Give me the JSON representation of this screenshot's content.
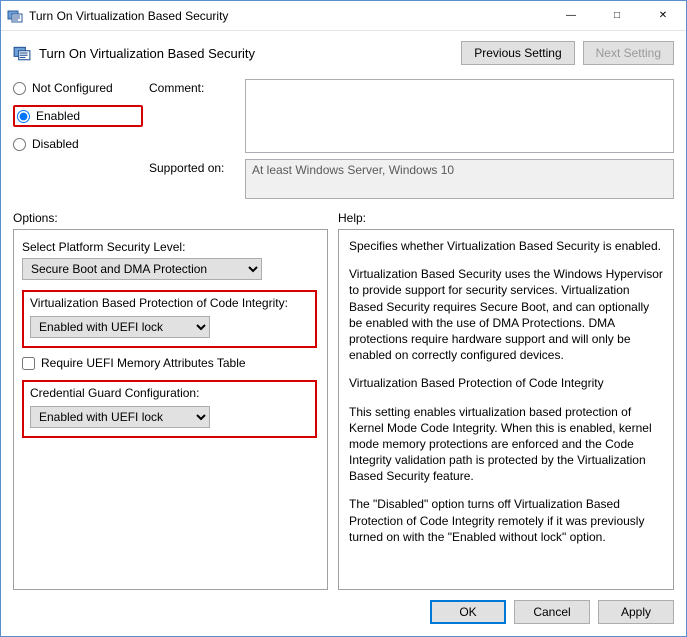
{
  "window": {
    "title": "Turn On Virtualization Based Security",
    "subtitle": "Turn On Virtualization Based Security"
  },
  "nav": {
    "prev": "Previous Setting",
    "next": "Next Setting"
  },
  "state": {
    "not_configured": "Not Configured",
    "enabled": "Enabled",
    "disabled": "Disabled",
    "selected": "enabled"
  },
  "labels": {
    "comment": "Comment:",
    "supported": "Supported on:",
    "options": "Options:",
    "help": "Help:"
  },
  "supported_on": "At least Windows Server, Windows 10",
  "options": {
    "platform_label": "Select Platform Security Level:",
    "platform_value": "Secure Boot and DMA Protection",
    "vbpci_label": "Virtualization Based Protection of Code Integrity:",
    "vbpci_value": "Enabled with UEFI lock",
    "require_uefi": "Require UEFI Memory Attributes Table",
    "require_uefi_checked": false,
    "credguard_label": "Credential Guard Configuration:",
    "credguard_value": "Enabled with UEFI lock"
  },
  "help": {
    "p1": "Specifies whether Virtualization Based Security is enabled.",
    "p2": "Virtualization Based Security uses the Windows Hypervisor to provide support for security services. Virtualization Based Security requires Secure Boot, and can optionally be enabled with the use of DMA Protections. DMA protections require hardware support and will only be enabled on correctly configured devices.",
    "p3": "Virtualization Based Protection of Code Integrity",
    "p4": "This setting enables virtualization based protection of Kernel Mode Code Integrity. When this is enabled, kernel mode memory protections are enforced and the Code Integrity validation path is protected by the Virtualization Based Security feature.",
    "p5": "The \"Disabled\" option turns off Virtualization Based Protection of Code Integrity remotely if it was previously turned on with the \"Enabled without lock\" option."
  },
  "footer": {
    "ok": "OK",
    "cancel": "Cancel",
    "apply": "Apply"
  }
}
